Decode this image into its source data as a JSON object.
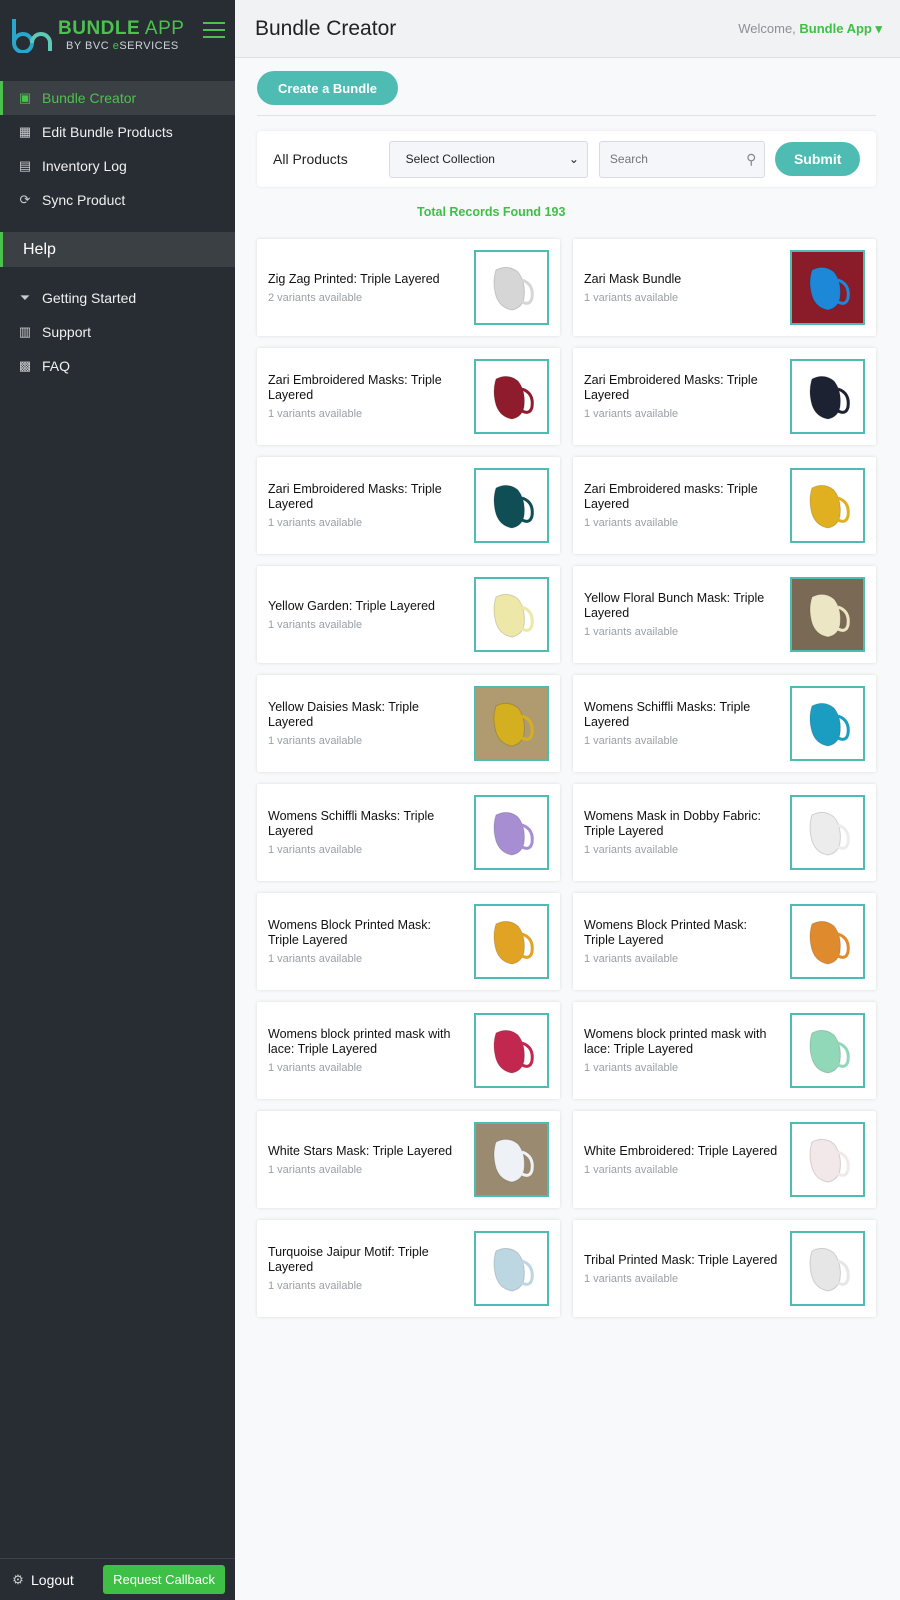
{
  "brand": {
    "title_bold": "BUNDLE",
    "title_light": " APP",
    "sub_prefix": "BY BVC ",
    "sub_e": "e",
    "sub_suffix": "SERVICES",
    "accent": "#4cc14e",
    "teal": "#4fbcb4"
  },
  "sidebar": {
    "items": [
      {
        "label": "Bundle Creator",
        "icon": "box-icon",
        "glyph": "▣",
        "active": true
      },
      {
        "label": "Edit Bundle Products",
        "icon": "grid-edit-icon",
        "glyph": "▦"
      },
      {
        "label": "Inventory Log",
        "icon": "document-icon",
        "glyph": "▤"
      },
      {
        "label": "Sync Product",
        "icon": "sync-icon",
        "glyph": "⟳"
      }
    ],
    "help_label": "Help",
    "help_items": [
      {
        "label": "Getting Started",
        "icon": "funnel-icon",
        "glyph": "⏷"
      },
      {
        "label": "Support",
        "icon": "chart-icon",
        "glyph": "▥"
      },
      {
        "label": "FAQ",
        "icon": "faq-icon",
        "glyph": "▩"
      }
    ],
    "logout": "Logout",
    "callback": "Request Callback"
  },
  "header": {
    "title": "Bundle Creator",
    "welcome": "Welcome, ",
    "user": "Bundle App"
  },
  "main": {
    "create_label": "Create a Bundle",
    "filter_label": "All Products",
    "select_value": "Select Collection",
    "search_placeholder": "Search",
    "submit_label": "Submit",
    "total": "Total Records Found 193"
  },
  "products": [
    {
      "title": "Zig Zag Printed: Triple Layered",
      "variants": "2 variants available",
      "color": "#d6d6d6",
      "bg": "#ffffff"
    },
    {
      "title": "Zari Mask Bundle",
      "variants": "1 variants available",
      "color": "#1e88d8",
      "bg": "#8a1c2a"
    },
    {
      "title": "Zari Embroidered Masks: Triple Layered",
      "variants": "1 variants available",
      "color": "#8e1c2c",
      "bg": "#ffffff"
    },
    {
      "title": "Zari Embroidered Masks: Triple Layered",
      "variants": "1 variants available",
      "color": "#1d2233",
      "bg": "#ffffff"
    },
    {
      "title": "Zari Embroidered Masks: Triple Layered",
      "variants": "1 variants available",
      "color": "#0f4e55",
      "bg": "#ffffff"
    },
    {
      "title": "Zari Embroidered masks: Triple Layered",
      "variants": "1 variants available",
      "color": "#e0b020",
      "bg": "#ffffff"
    },
    {
      "title": "Yellow Garden: Triple Layered",
      "variants": "1 variants available",
      "color": "#eee8a8",
      "bg": "#ffffff"
    },
    {
      "title": "Yellow Floral Bunch Mask: Triple Layered",
      "variants": "1 variants available",
      "color": "#ede6c4",
      "bg": "#7a6a55"
    },
    {
      "title": "Yellow Daisies Mask: Triple Layered",
      "variants": "1 variants available",
      "color": "#d4b020",
      "bg": "#b09a70"
    },
    {
      "title": "Womens Schiffli Masks: Triple Layered",
      "variants": "1 variants available",
      "color": "#1b9dc2",
      "bg": "#ffffff"
    },
    {
      "title": "Womens Schiffli Masks: Triple Layered",
      "variants": "1 variants available",
      "color": "#a78ed2",
      "bg": "#ffffff"
    },
    {
      "title": "Womens Mask in Dobby Fabric: Triple Layered",
      "variants": "1 variants available",
      "color": "#ececec",
      "bg": "#ffffff"
    },
    {
      "title": "Womens Block Printed Mask: Triple Layered",
      "variants": "1 variants available",
      "color": "#e1a323",
      "bg": "#ffffff"
    },
    {
      "title": "Womens Block Printed Mask: Triple Layered",
      "variants": "1 variants available",
      "color": "#e08a2e",
      "bg": "#ffffff"
    },
    {
      "title": "Womens block printed mask with lace: Triple Layered",
      "variants": "1 variants available",
      "color": "#c2284f",
      "bg": "#ffffff"
    },
    {
      "title": "Womens block printed mask with lace: Triple Layered",
      "variants": "1 variants available",
      "color": "#90d8b8",
      "bg": "#ffffff"
    },
    {
      "title": "White Stars Mask: Triple Layered",
      "variants": "1 variants available",
      "color": "#eef2f6",
      "bg": "#9a8a70"
    },
    {
      "title": "White Embroidered: Triple Layered",
      "variants": "1 variants available",
      "color": "#f2e8ea",
      "bg": "#ffffff"
    },
    {
      "title": "Turquoise Jaipur Motif: Triple Layered",
      "variants": "1 variants available",
      "color": "#bcd6e2",
      "bg": "#ffffff"
    },
    {
      "title": "Tribal Printed Mask: Triple Layered",
      "variants": "1 variants available",
      "color": "#e6e6e6",
      "bg": "#ffffff"
    }
  ]
}
